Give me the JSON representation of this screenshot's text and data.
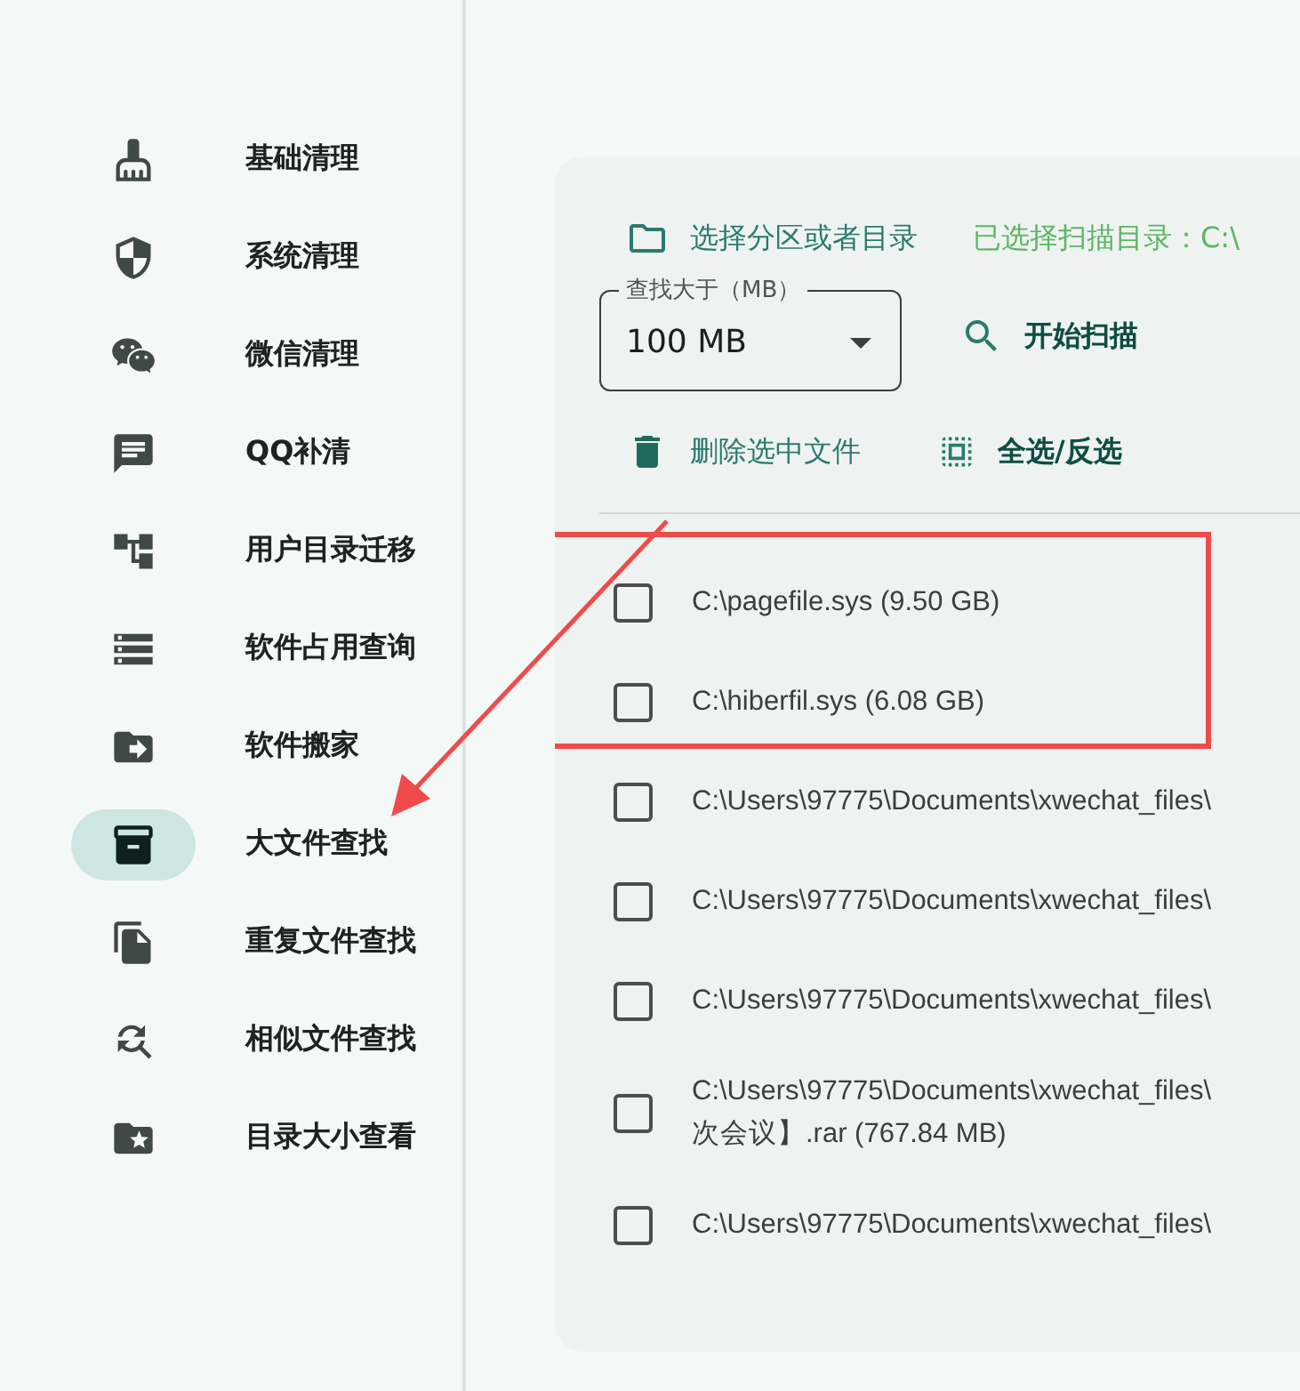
{
  "sidebar": {
    "items": [
      {
        "label": "基础清理",
        "selected": false
      },
      {
        "label": "系统清理",
        "selected": false
      },
      {
        "label": "微信清理",
        "selected": false
      },
      {
        "label": "QQ补清",
        "selected": false
      },
      {
        "label": "用户目录迁移",
        "selected": false
      },
      {
        "label": "软件占用查询",
        "selected": false
      },
      {
        "label": "软件搬家",
        "selected": false
      },
      {
        "label": "大文件查找",
        "selected": true
      },
      {
        "label": "重复文件查找",
        "selected": false
      },
      {
        "label": "相似文件查找",
        "selected": false
      },
      {
        "label": "目录大小查看",
        "selected": false
      }
    ]
  },
  "panel": {
    "directory_button": "选择分区或者目录",
    "selected_directory": "已选择扫描目录：C:\\",
    "size_select": {
      "label": "查找大于（MB）",
      "value": "100 MB"
    },
    "scan_button": "开始扫描",
    "delete_button": "删除选中文件",
    "select_all_button": "全选/反选",
    "files": [
      {
        "lines": [
          "C:\\pagefile.sys (9.50 GB)"
        ],
        "checked": false,
        "highlighted": true
      },
      {
        "lines": [
          "C:\\hiberfil.sys (6.08 GB)"
        ],
        "checked": false,
        "highlighted": true
      },
      {
        "lines": [
          "C:\\Users\\97775\\Documents\\xwechat_files\\"
        ],
        "checked": false,
        "highlighted": false
      },
      {
        "lines": [
          "C:\\Users\\97775\\Documents\\xwechat_files\\"
        ],
        "checked": false,
        "highlighted": false
      },
      {
        "lines": [
          "C:\\Users\\97775\\Documents\\xwechat_files\\"
        ],
        "checked": false,
        "highlighted": false
      },
      {
        "lines": [
          "C:\\Users\\97775\\Documents\\xwechat_files\\",
          "次会议】.rar (767.84 MB)"
        ],
        "checked": false,
        "highlighted": false
      },
      {
        "lines": [
          "C:\\Users\\97775\\Documents\\xwechat_files\\"
        ],
        "checked": false,
        "highlighted": false
      }
    ]
  }
}
